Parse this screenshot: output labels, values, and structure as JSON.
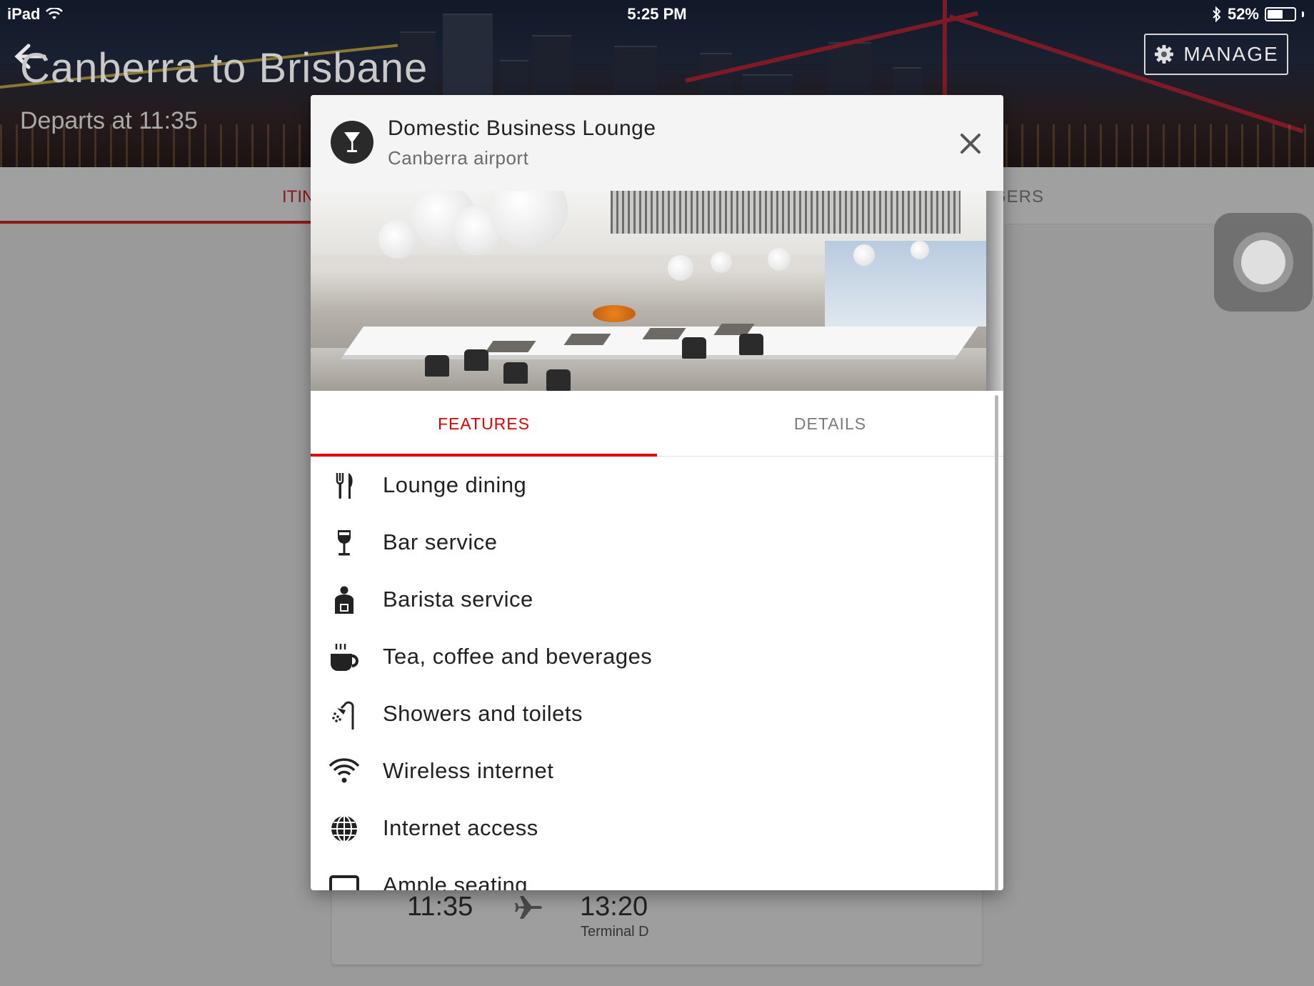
{
  "status_bar": {
    "device": "iPad",
    "time": "5:25 PM",
    "battery": "52%",
    "icons": [
      "wifi-icon",
      "bluetooth-icon",
      "battery-icon"
    ]
  },
  "trip_header": {
    "title": "Canberra to Brisbane",
    "subtitle": "Departs at 11:35",
    "manage_label": "MANAGE"
  },
  "background_tabs": {
    "left_partial": "ITIN",
    "right_partial": "GERS"
  },
  "flight_card": {
    "departure_time": "11:35",
    "arrival_time": "13:20",
    "arrival_terminal": "Terminal D"
  },
  "modal": {
    "title": "Domestic Business Lounge",
    "subtitle": "Canberra airport",
    "icon": "cocktail-icon",
    "tabs": [
      {
        "label": "FEATURES",
        "active": true
      },
      {
        "label": "DETAILS",
        "active": false
      }
    ],
    "features": [
      {
        "label": "Lounge dining",
        "icon": "cutlery-icon"
      },
      {
        "label": "Bar service",
        "icon": "wine-glass-icon"
      },
      {
        "label": "Barista service",
        "icon": "barista-icon"
      },
      {
        "label": "Tea, coffee and beverages",
        "icon": "coffee-cup-icon"
      },
      {
        "label": "Showers and toilets",
        "icon": "shower-icon"
      },
      {
        "label": "Wireless internet",
        "icon": "wifi-icon"
      },
      {
        "label": "Internet access",
        "icon": "globe-icon"
      },
      {
        "label": "Ample seating",
        "icon": "seat-icon"
      }
    ]
  },
  "colors": {
    "accent": "#e40000",
    "dim_accent": "#8c1818",
    "text": "#222222"
  }
}
